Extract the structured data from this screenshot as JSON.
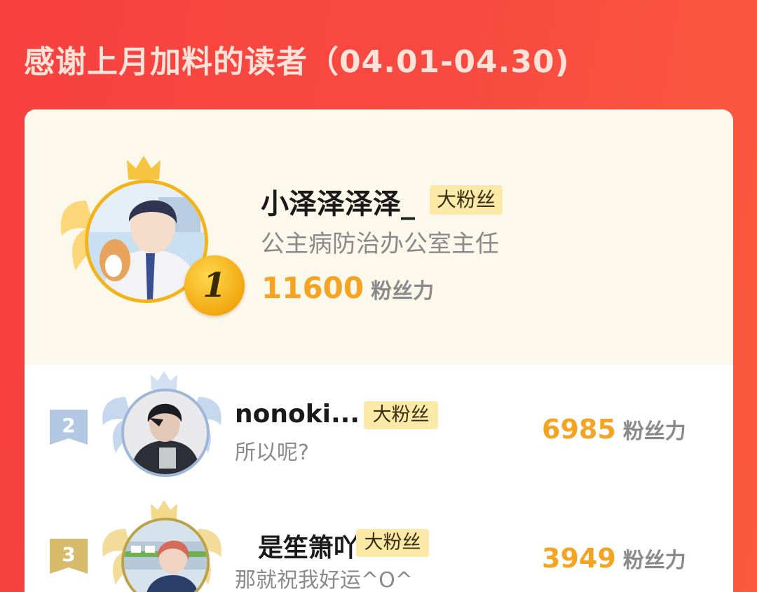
{
  "header": {
    "title": "感谢上月加料的读者（04.01-04.30)"
  },
  "ranking": [
    {
      "rank": "1",
      "name": "小泽泽泽泽_",
      "badge": "大粉丝",
      "subtitle": "公主病防治办公室主任",
      "score": "11600",
      "unit": "粉丝力"
    },
    {
      "rank": "2",
      "name": "nonoki...",
      "badge": "大粉丝",
      "subtitle": "所以呢?",
      "score": "6985",
      "unit": "粉丝力"
    },
    {
      "rank": "3",
      "name": "是笙箫吖",
      "badge": "大粉丝",
      "subtitle": "那就祝我好运^O^",
      "score": "3949",
      "unit": "粉丝力"
    }
  ],
  "colors": {
    "background": "#f7413f",
    "score": "#f5a322",
    "badge_bg": "#fbe9a8",
    "gold": "#f2b31b",
    "silver": "#a9c1de",
    "bronze": "#d8bb6a"
  }
}
